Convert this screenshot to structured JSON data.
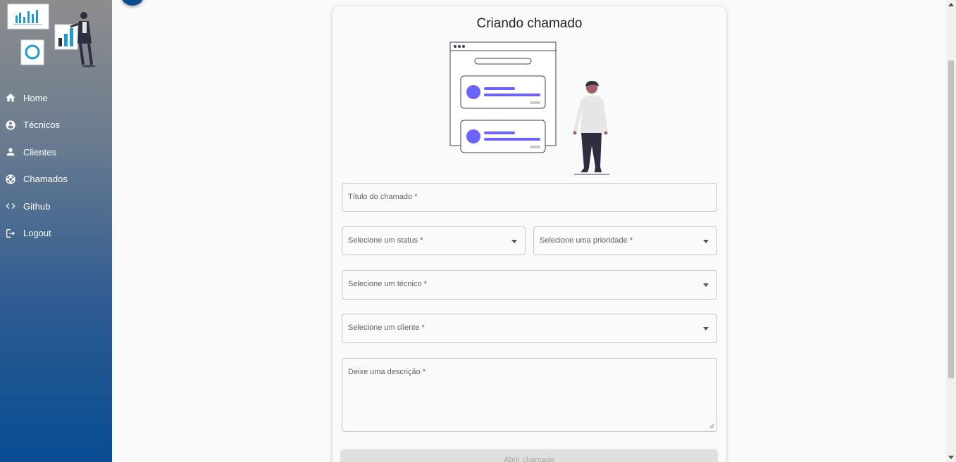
{
  "sidebar": {
    "items": [
      {
        "label": "Home",
        "icon": "home-icon"
      },
      {
        "label": "Técnicos",
        "icon": "account-circle-icon"
      },
      {
        "label": "Clientes",
        "icon": "person-icon"
      },
      {
        "label": "Chamados",
        "icon": "support-icon"
      },
      {
        "label": "Github",
        "icon": "code-icon"
      },
      {
        "label": "Logout",
        "icon": "logout-icon"
      }
    ]
  },
  "form": {
    "title": "Criando chamado",
    "titulo_placeholder": "Título do chamado *",
    "status_placeholder": "Selecione um status *",
    "prioridade_placeholder": "Selecione uma prioridade *",
    "tecnico_placeholder": "Selecione um técnico *",
    "cliente_placeholder": "Selecione um cliente *",
    "descricao_placeholder": "Deixe uma descrição *",
    "submit_label": "Abrir chamado"
  },
  "colors": {
    "accent": "#6c63ff",
    "sidebar_bottom": "#064c93",
    "sidebar_top": "#8d8d8d"
  }
}
